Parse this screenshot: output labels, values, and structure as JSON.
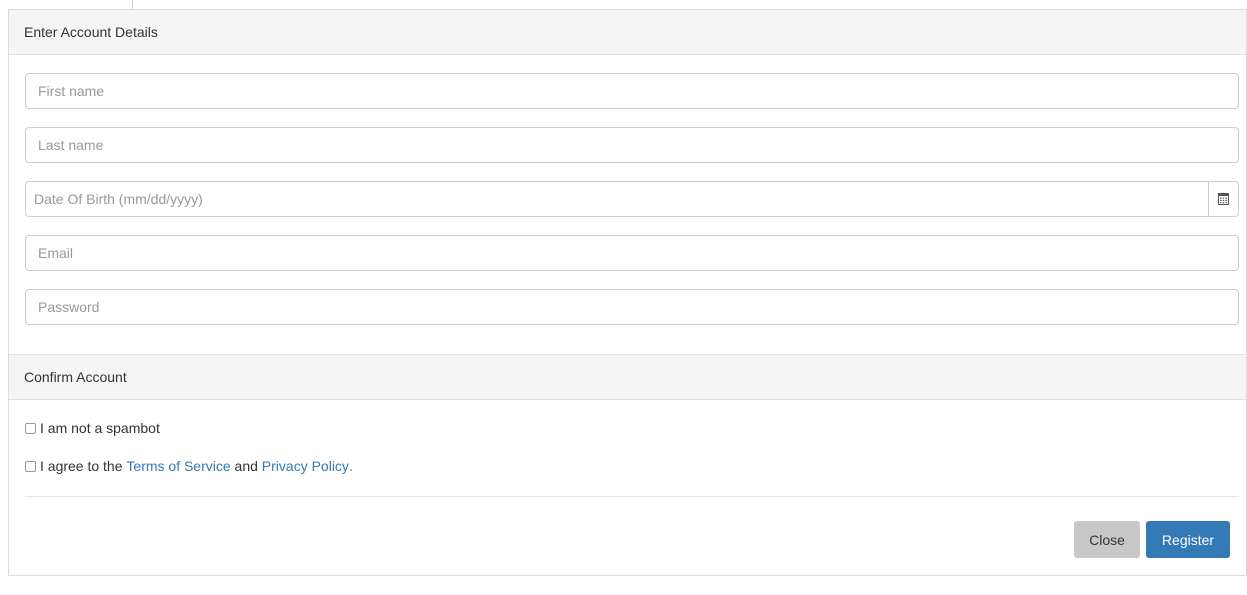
{
  "account_section": {
    "title": "Enter Account Details",
    "first_name_placeholder": "First name",
    "last_name_placeholder": "Last name",
    "dob_placeholder": "Date Of Birth (mm/dd/yyyy)",
    "dob_icon": "calendar-icon",
    "email_placeholder": "Email",
    "password_placeholder": "Password"
  },
  "confirm_section": {
    "title": "Confirm Account",
    "spambot_label": "I am not a spambot",
    "agree_prefix": "I agree to the ",
    "terms_link": "Terms of Service",
    "agree_middle": " and ",
    "privacy_link": "Privacy Policy",
    "agree_suffix": "."
  },
  "footer": {
    "close_label": "Close",
    "register_label": "Register"
  },
  "colors": {
    "link": "#337ab7",
    "primary_button": "#337ab7",
    "secondary_button": "#c8c8c8",
    "heading_bg": "#f5f5f5"
  }
}
